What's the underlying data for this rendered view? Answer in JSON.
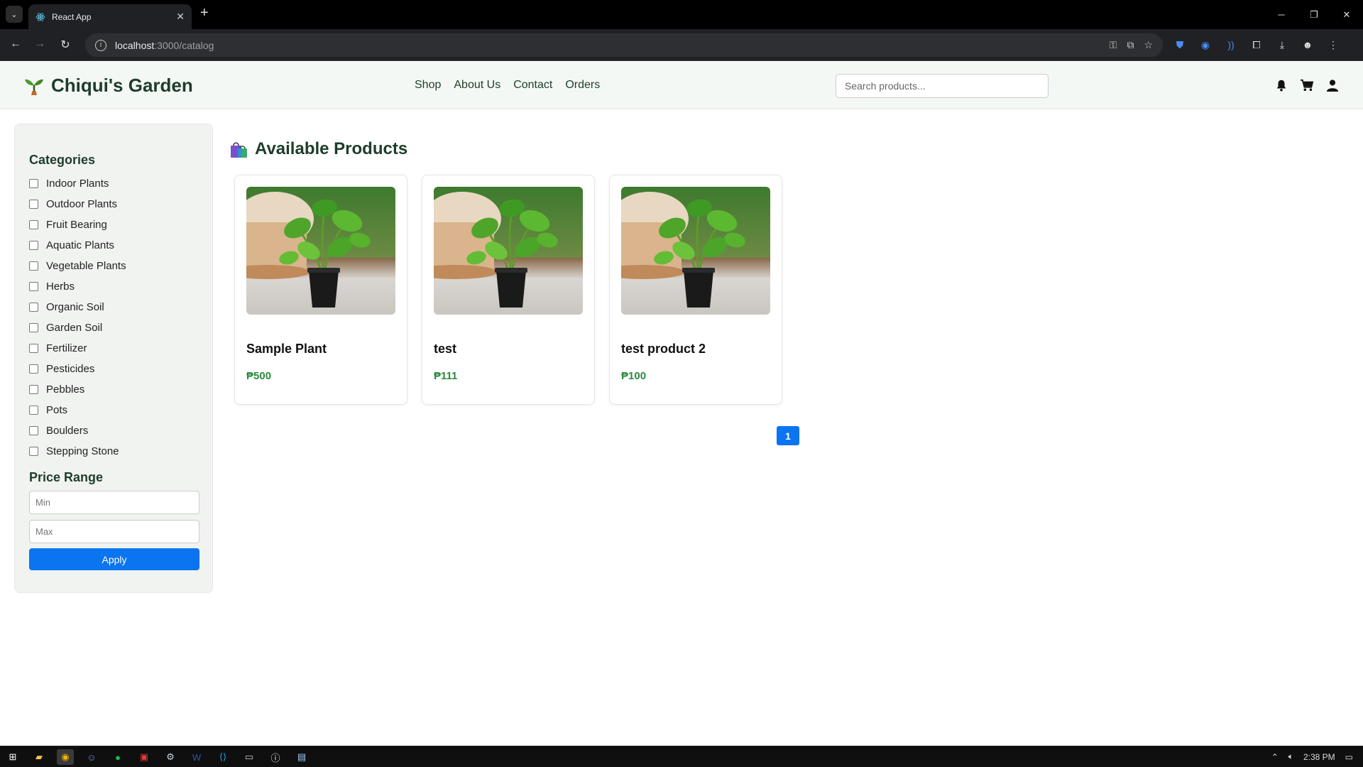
{
  "browser": {
    "tab_title": "React App",
    "url_host": "localhost",
    "url_path": ":3000/catalog"
  },
  "header": {
    "brand": "Chiqui's Garden",
    "nav": [
      "Shop",
      "About Us",
      "Contact",
      "Orders"
    ],
    "search_placeholder": "Search products..."
  },
  "sidebar": {
    "categories_heading": "Categories",
    "categories": [
      "Indoor Plants",
      "Outdoor Plants",
      "Fruit Bearing",
      "Aquatic Plants",
      "Vegetable Plants",
      "Herbs",
      "Organic Soil",
      "Garden Soil",
      "Fertilizer",
      "Pesticides",
      "Pebbles",
      "Pots",
      "Boulders",
      "Stepping Stone"
    ],
    "price_heading": "Price Range",
    "min_placeholder": "Min",
    "max_placeholder": "Max",
    "apply_label": "Apply"
  },
  "products": {
    "heading": "Available Products",
    "items": [
      {
        "name": "Sample Plant",
        "price": "₱500"
      },
      {
        "name": "test",
        "price": "₱111"
      },
      {
        "name": "test product 2",
        "price": "₱100"
      }
    ],
    "current_page": "1"
  },
  "taskbar": {
    "time": "2:38 PM"
  },
  "colors": {
    "brand_green": "#1e3d2b",
    "price_green": "#2b8a3e",
    "accent_blue": "#0b74f0"
  }
}
